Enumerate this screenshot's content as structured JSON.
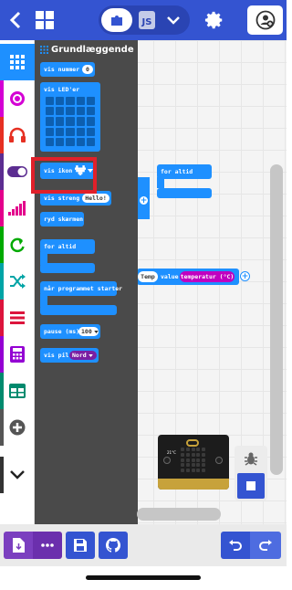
{
  "header": {
    "js_label": "JS"
  },
  "flyout": {
    "title": "Grundlæggende",
    "blocks": {
      "show_number": "vis nummer",
      "show_number_value": "0",
      "show_leds": "vis LED'er",
      "show_icon": "vis ikon",
      "show_string": "vis streng",
      "show_string_value": "Hello!",
      "clear_screen": "ryd skærmen",
      "forever": "for altid",
      "on_start": "når programmet starter",
      "pause": "pause (ms)",
      "pause_value": "100",
      "show_arrow": "vis pil",
      "show_arrow_value": "Nord"
    }
  },
  "canvas": {
    "forever_label": "for altid",
    "temp_var": "Temp",
    "value_label": "value",
    "temperature_label": "temperatur (°C)"
  },
  "simulator": {
    "temp_readout": "21°C"
  },
  "colors": {
    "header": "#3454d1",
    "block_basic": "#1e90ff",
    "highlight": "#e0202a",
    "flyout": "#4a4a4a"
  },
  "categories": [
    {
      "name": "basic",
      "color": "#1e90ff",
      "icon": "grid-icon"
    },
    {
      "name": "input",
      "color": "#d400d4",
      "icon": "target-icon"
    },
    {
      "name": "music",
      "color": "#e63022",
      "icon": "headphones-icon"
    },
    {
      "name": "led",
      "color": "#5c2d91",
      "icon": "toggle-icon"
    },
    {
      "name": "radio",
      "color": "#e3008c",
      "icon": "signal-icon"
    },
    {
      "name": "loops",
      "color": "#00aa00",
      "icon": "loop-icon"
    },
    {
      "name": "logic",
      "color": "#00a4a6",
      "icon": "shuffle-icon"
    },
    {
      "name": "variables",
      "color": "#dc143c",
      "icon": "lines-icon"
    },
    {
      "name": "math",
      "color": "#9400d3",
      "icon": "calculator-icon"
    },
    {
      "name": "arrays",
      "color": "#008a6e",
      "icon": "table-icon"
    },
    {
      "name": "extensions",
      "color": "#555555",
      "icon": "plus-icon"
    },
    {
      "name": "advanced",
      "color": "#333333",
      "icon": "chevron-down-icon"
    }
  ]
}
